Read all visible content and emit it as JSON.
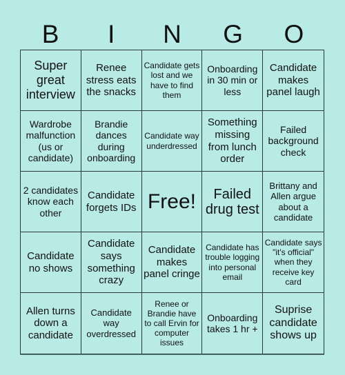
{
  "header": {
    "letters": [
      "B",
      "I",
      "N",
      "G",
      "O"
    ]
  },
  "board": {
    "background": "#b8ebe6",
    "cells": [
      "Super great interview",
      "Renee stress eats the snacks",
      "Candidate gets lost and we have to find them",
      "Onboarding in 30 min or less",
      "Candidate makes panel laugh",
      "Wardrobe malfunction (us or candidate)",
      "Brandie dances during onboarding",
      "Candidate way underdressed",
      "Something missing from lunch order",
      "Failed background check",
      "2 candidates know each other",
      "Candidate forgets IDs",
      "Free!",
      "Failed drug test",
      "Brittany and Allen argue about a candidate",
      "Candidate no shows",
      "Candidate says something crazy",
      "Candidate makes panel cringe",
      "Candidate has trouble logging into personal email",
      "Candidate says \"it's official\" when they receive key card",
      "Allen turns down a candidate",
      "Candidate way overdressed",
      "Renee or Brandie have to call Ervin for computer issues",
      "Onboarding takes 1 hr +",
      "Suprise candidate shows up"
    ]
  }
}
